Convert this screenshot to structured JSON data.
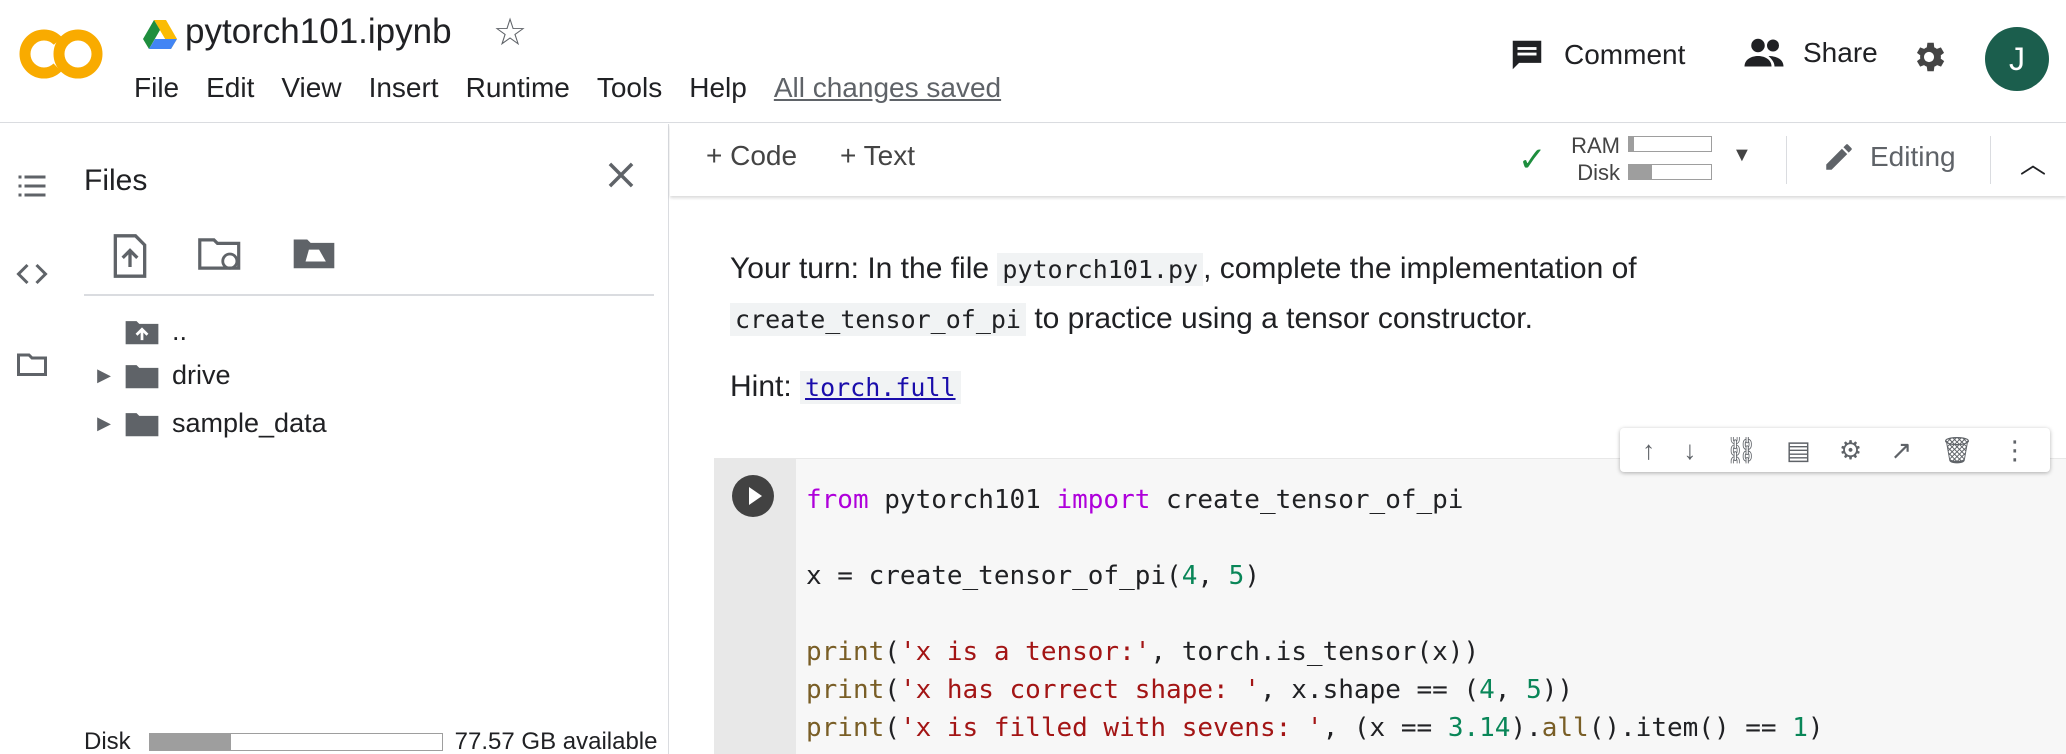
{
  "header": {
    "notebook_title": "pytorch101.ipynb",
    "menu": [
      "File",
      "Edit",
      "View",
      "Insert",
      "Runtime",
      "Tools",
      "Help"
    ],
    "save_status": "All changes saved",
    "comment_label": "Comment",
    "share_label": "Share",
    "avatar_initial": "J",
    "colors": {
      "logo_orange": "#f9ab00",
      "avatar": "#1b5e4d"
    }
  },
  "files_panel": {
    "title": "Files",
    "tree": [
      {
        "name": "..",
        "type": "parent"
      },
      {
        "name": "drive",
        "type": "folder"
      },
      {
        "name": "sample_data",
        "type": "folder"
      }
    ],
    "disk_label": "Disk",
    "disk_available": "77.57 GB available",
    "disk_used_fraction": 0.28
  },
  "toolbar": {
    "add_code": "+ Code",
    "add_text": "+ Text",
    "ram_label": "RAM",
    "disk_label": "Disk",
    "ram_fraction": 0.06,
    "disk_fraction": 0.28,
    "editing_label": "Editing"
  },
  "notebook": {
    "md1_pre": "Your turn: In the file ",
    "md1_code": "pytorch101.py",
    "md1_post": ", complete the implementation of",
    "md2_code": "create_tensor_of_pi",
    "md2_post": " to practice using a tensor constructor.",
    "hint_label": "Hint: ",
    "hint_link": "torch.full"
  }
}
